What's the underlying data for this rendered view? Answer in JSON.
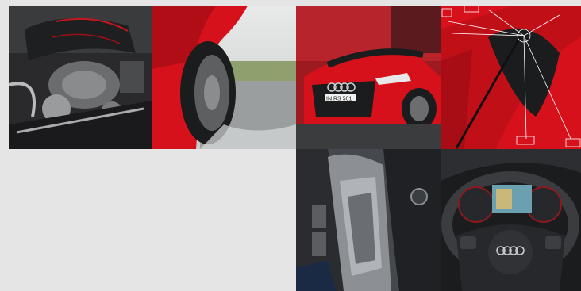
{
  "gallery": {
    "tiles": [
      {
        "id": "engine",
        "subject": "engine-bay"
      },
      {
        "id": "wheel",
        "subject": "wheel-on-wet-road"
      },
      {
        "id": "front",
        "subject": "car-front",
        "plate_text": "IN RS 501"
      },
      {
        "id": "diagram",
        "subject": "sensor-diagram"
      },
      {
        "id": "door",
        "subject": "door-controls"
      },
      {
        "id": "cockpit",
        "subject": "steering-wheel-cockpit"
      }
    ]
  },
  "colors": {
    "background": "#e5e5e5",
    "car_red": "#d6111b",
    "dark": "#1b1c1e"
  }
}
